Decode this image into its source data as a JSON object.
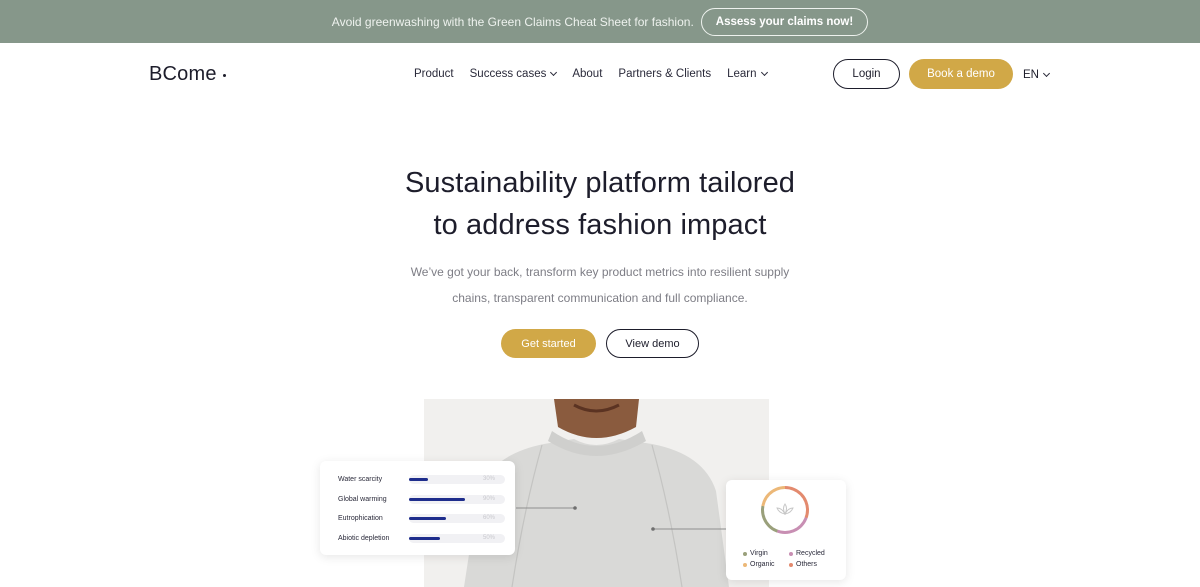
{
  "announcement": {
    "text": "Avoid greenwashing with the Green Claims Cheat Sheet for fashion.",
    "button": "Assess your claims now!"
  },
  "header": {
    "logo": "BCome",
    "nav": [
      {
        "label": "Product",
        "dropdown": false
      },
      {
        "label": "Success cases",
        "dropdown": true
      },
      {
        "label": "About",
        "dropdown": false
      },
      {
        "label": "Partners & Clients",
        "dropdown": false
      },
      {
        "label": "Learn",
        "dropdown": true
      }
    ],
    "login": "Login",
    "book_demo": "Book a demo",
    "language": "EN"
  },
  "hero": {
    "title_line1": "Sustainability platform tailored",
    "title_line2": "to address fashion impact",
    "subtitle_line1": "We’ve got your back, transform key product metrics into resilient supply",
    "subtitle_line2": "chains, transparent communication and full compliance.",
    "primary_cta": "Get started",
    "secondary_cta": "View demo"
  },
  "metrics_card": {
    "rows": [
      {
        "label": "Water scarcity",
        "value": "30%",
        "fill": 0.3
      },
      {
        "label": "Global warming",
        "value": "90%",
        "fill": 0.9
      },
      {
        "label": "Eutrophication",
        "value": "60%",
        "fill": 0.6
      },
      {
        "label": "Abiotic depletion",
        "value": "50%",
        "fill": 0.5
      }
    ]
  },
  "materials_card": {
    "icon": "lotus-icon",
    "legend": [
      {
        "label": "Virgin",
        "color": "#9aa07b"
      },
      {
        "label": "Recycled",
        "color": "#c88fb3"
      },
      {
        "label": "Organic",
        "color": "#ecb878"
      },
      {
        "label": "Others",
        "color": "#e38a6e"
      }
    ]
  },
  "colors": {
    "accent": "#d1a847",
    "announcement_bg": "#86978a",
    "bar_fill": "#1e2d8c",
    "text_dark": "#1d1d2b"
  }
}
